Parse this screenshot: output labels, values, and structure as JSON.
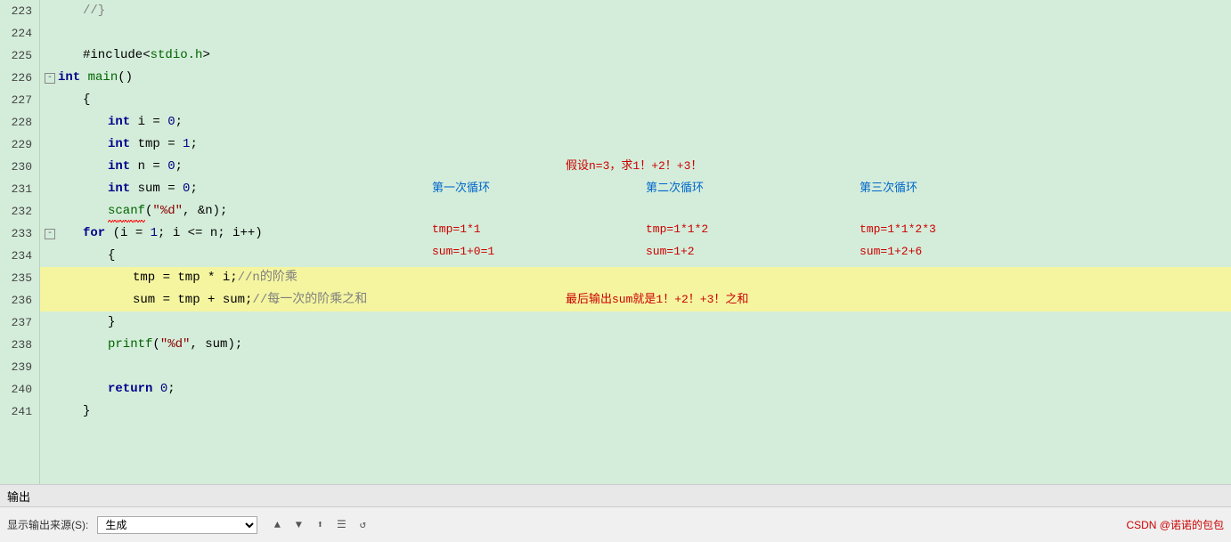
{
  "editor": {
    "background": "#d4edda",
    "lines": [
      {
        "num": 223,
        "code": "//}",
        "indent": 1,
        "highlight": false
      },
      {
        "num": 224,
        "code": "",
        "indent": 0,
        "highlight": false
      },
      {
        "num": 225,
        "code": "#include<stdio.h>",
        "indent": 1,
        "highlight": false
      },
      {
        "num": 226,
        "code": "int main()",
        "indent": 0,
        "highlight": false,
        "fold": true
      },
      {
        "num": 227,
        "code": "{",
        "indent": 1,
        "highlight": false
      },
      {
        "num": 228,
        "code": "int i = 0;",
        "indent": 2,
        "highlight": false
      },
      {
        "num": 229,
        "code": "int tmp = 1;",
        "indent": 2,
        "highlight": false
      },
      {
        "num": 230,
        "code": "int n = 0;",
        "indent": 2,
        "highlight": false
      },
      {
        "num": 231,
        "code": "int sum = 0;",
        "indent": 2,
        "highlight": false
      },
      {
        "num": 232,
        "code": "scanf(\"%d\", &n);",
        "indent": 2,
        "highlight": false
      },
      {
        "num": 233,
        "code": "for (i = 1; i <= n; i++)",
        "indent": 1,
        "highlight": false,
        "fold": true
      },
      {
        "num": 234,
        "code": "{",
        "indent": 2,
        "highlight": false
      },
      {
        "num": 235,
        "code": "tmp = tmp * i;//n的阶乘",
        "indent": 3,
        "highlight": true
      },
      {
        "num": 236,
        "code": "sum = tmp + sum;//每一次的阶乘之和",
        "indent": 3,
        "highlight": true
      },
      {
        "num": 237,
        "code": "}",
        "indent": 2,
        "highlight": false
      },
      {
        "num": 238,
        "code": "printf(\"%d\", sum);",
        "indent": 2,
        "highlight": false
      },
      {
        "num": 239,
        "code": "",
        "indent": 0,
        "highlight": false
      },
      {
        "num": 240,
        "code": "return 0;",
        "indent": 2,
        "highlight": false
      },
      {
        "num": 241,
        "code": "}",
        "indent": 1,
        "highlight": false
      }
    ],
    "annotations": {
      "assume": "假设n=3，求1！+2！+3！",
      "loop1": "第一次循环",
      "loop2": "第二次循环",
      "loop3": "第三次循环",
      "tmp1": "tmp=1*1",
      "tmp2": "tmp=1*1*2",
      "tmp3": "tmp=1*1*2*3",
      "sum1": "sum=1+0=1",
      "sum2": "sum=1+2",
      "sum3": "sum=1+2+6",
      "final": "最后输出sum就是1！+2！+3！之和"
    }
  },
  "output_panel": {
    "title": "输出",
    "source_label": "显示输出来源(S):",
    "source_value": "生成",
    "csdn_label": "CSDN @诺诺的包包"
  }
}
